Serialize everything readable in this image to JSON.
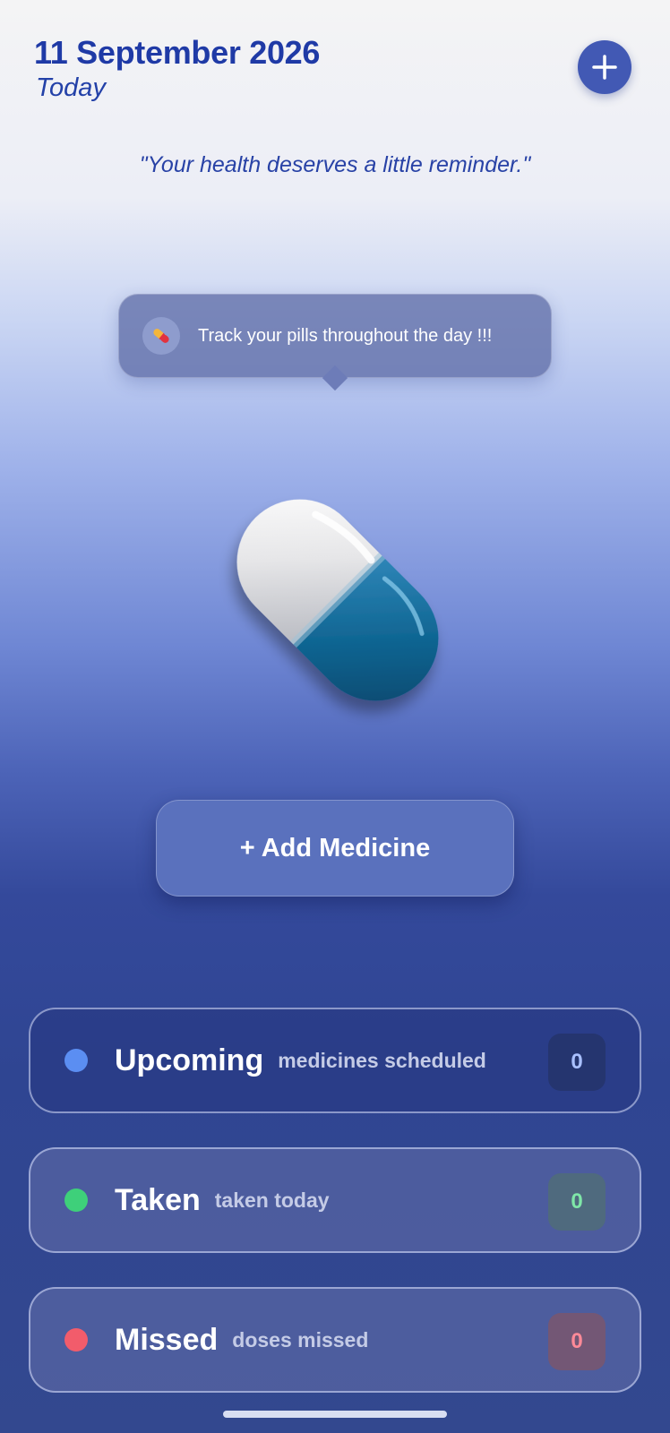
{
  "header": {
    "date": "11 September 2026",
    "day_label": "Today"
  },
  "quote": "\"Your health deserves a little reminder.\"",
  "tooltip": {
    "text": "Track your pills throughout the day !!!",
    "icon": "pill-icon"
  },
  "hero": {
    "icon": "capsule-icon"
  },
  "add_medicine_label": "+ Add Medicine",
  "stats": {
    "upcoming": {
      "title": "Upcoming",
      "subtitle": "medicines scheduled",
      "count": "0",
      "color": "#5b8ef2",
      "count_color": "#a9c0ff"
    },
    "taken": {
      "title": "Taken",
      "subtitle": "taken today",
      "count": "0",
      "color": "#3ed07a",
      "count_color": "#7fe6a8"
    },
    "missed": {
      "title": "Missed",
      "subtitle": "doses missed",
      "count": "0",
      "color": "#f25c6b",
      "count_color": "#ff8a98"
    }
  },
  "colors": {
    "accent": "#1f3aa6",
    "button": "#4259b4"
  }
}
